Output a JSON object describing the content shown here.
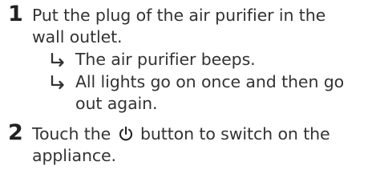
{
  "steps": [
    {
      "number": "1",
      "text": "Put the plug of the air purifier in the wall outlet.",
      "results": [
        {
          "arrow_icon": "result-arrow-icon",
          "text": "The air purifier beeps."
        },
        {
          "arrow_icon": "result-arrow-icon",
          "text": "All lights go on once and then go out again."
        }
      ]
    },
    {
      "number": "2",
      "text_before_icon": "Touch the",
      "icon": "power-icon",
      "text_after_icon": "button to switch on the appliance."
    }
  ]
}
